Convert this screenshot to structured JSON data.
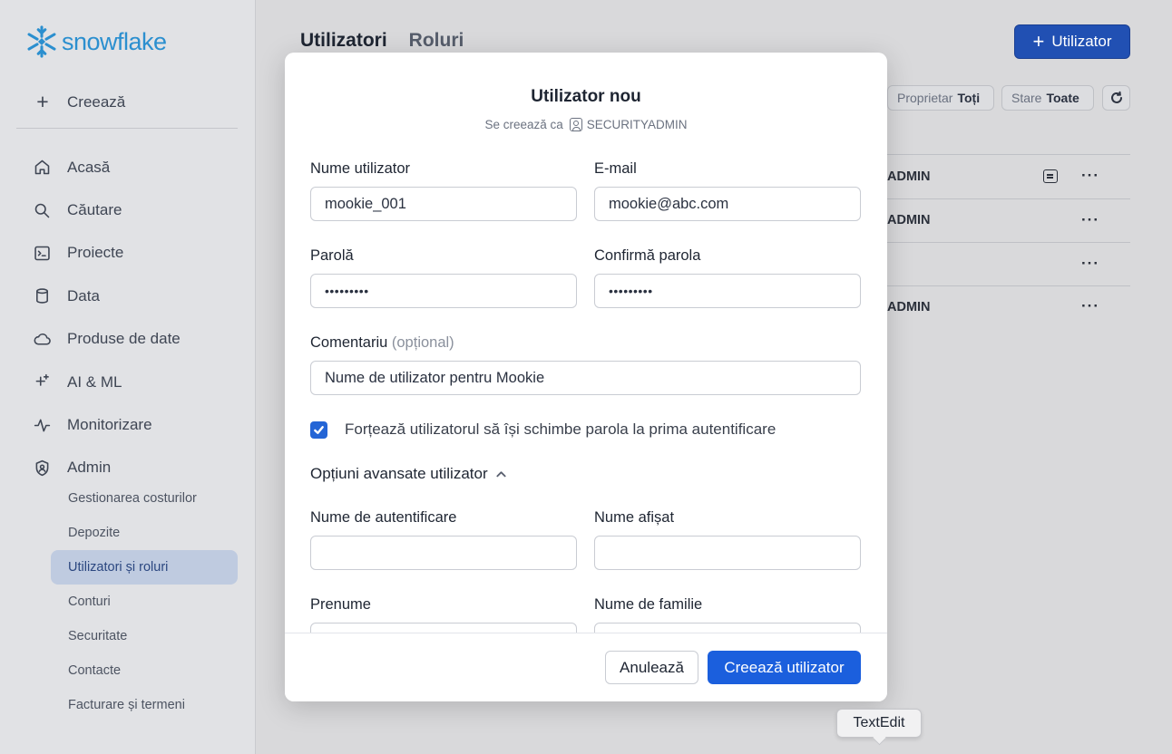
{
  "brand": {
    "logo_text": "snowflake",
    "color": "#2b8fcf"
  },
  "sidebar": {
    "create_label": "Creează",
    "items": [
      {
        "label": "Acasă",
        "icon": "home-icon"
      },
      {
        "label": "Căutare",
        "icon": "search-icon"
      },
      {
        "label": "Proiecte",
        "icon": "projects-icon"
      },
      {
        "label": "Data",
        "icon": "database-icon"
      },
      {
        "label": "Produse de date",
        "icon": "cloud-icon"
      },
      {
        "label": "AI & ML",
        "icon": "sparkle-icon"
      },
      {
        "label": "Monitorizare",
        "icon": "activity-icon"
      },
      {
        "label": "Admin",
        "icon": "shield-icon"
      }
    ],
    "admin_subitems": [
      {
        "label": "Gestionarea costurilor"
      },
      {
        "label": "Depozite"
      },
      {
        "label": "Utilizatori și roluri",
        "active": true
      },
      {
        "label": "Conturi"
      },
      {
        "label": "Securitate"
      },
      {
        "label": "Contacte"
      },
      {
        "label": "Facturare și termeni"
      }
    ]
  },
  "main": {
    "tabs": [
      {
        "label": "Utilizatori",
        "active": true
      },
      {
        "label": "Roluri",
        "active": false
      }
    ],
    "add_button_label": "Utilizator",
    "filters": [
      {
        "label": "Proprietar",
        "value": "Toți"
      },
      {
        "label": "Stare",
        "value": "Toate"
      }
    ],
    "rows": [
      {
        "owner": "ADMIN",
        "has_comment": true
      },
      {
        "owner": "ADMIN",
        "has_comment": false
      },
      {
        "owner": "",
        "has_comment": false
      },
      {
        "owner": "ADMIN",
        "has_comment": false
      }
    ],
    "more_glyph": "···"
  },
  "modal": {
    "title": "Utilizator nou",
    "subtitle_prefix": "Se creează ca",
    "role": "SECURITYADMIN",
    "fields": {
      "username": {
        "label": "Nume utilizator",
        "value": "mookie_001"
      },
      "email": {
        "label": "E-mail",
        "value": "mookie@abc.com"
      },
      "password": {
        "label": "Parolă",
        "value": "•••••••••"
      },
      "confirm_password": {
        "label": "Confirmă parola",
        "value": "•••••••••"
      },
      "comment": {
        "label": "Comentariu",
        "optional_label": "(opțional)",
        "value": "Nume de utilizator pentru Mookie"
      },
      "login_name": {
        "label": "Nume de autentificare",
        "value": ""
      },
      "display_name": {
        "label": "Nume afișat",
        "value": ""
      },
      "first_name": {
        "label": "Prenume",
        "value": ""
      },
      "last_name": {
        "label": "Nume de familie",
        "value": ""
      }
    },
    "force_password_change": {
      "label": "Forțează utilizatorul să își schimbe parola la prima autentificare",
      "checked": true
    },
    "advanced_options_label": "Opțiuni avansate utilizator",
    "cancel_label": "Anulează",
    "create_label": "Creează utilizator",
    "primary_color": "#1b5fdd"
  },
  "tooltip": {
    "text": "TextEdit"
  }
}
